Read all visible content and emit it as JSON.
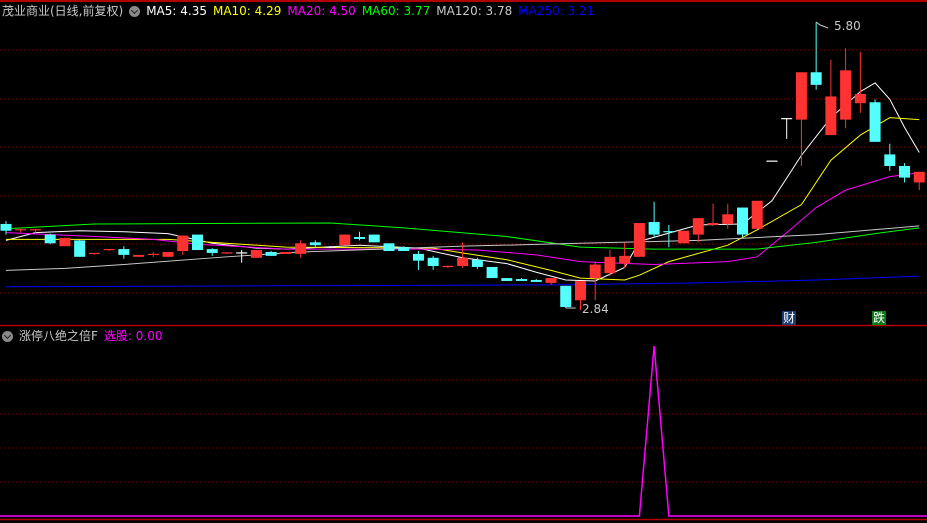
{
  "header": {
    "title": "茂业商业(日线,前复权)",
    "ma": [
      {
        "label": "MA5: 4.35",
        "color": "#ffffff"
      },
      {
        "label": "MA10: 4.29",
        "color": "#ffff00"
      },
      {
        "label": "MA20: 4.50",
        "color": "#ff00ff"
      },
      {
        "label": "MA60: 3.77",
        "color": "#00ff00"
      },
      {
        "label": "MA120: 3.78",
        "color": "#c8c8c8"
      },
      {
        "label": "MA250: 3.21",
        "color": "#0000ff"
      }
    ]
  },
  "indicator": {
    "title": "涨停八绝之倍F",
    "value_label": "选股: 0.00",
    "color": "#ff00ff"
  },
  "annotations": {
    "high_label": "5.80",
    "low_label": "2.84",
    "tag1": "财",
    "tag2": "跌"
  },
  "colors": {
    "up": "#ff3232",
    "down": "#54ffff",
    "flat": "#ffffff",
    "grid": "#8b0000",
    "border": "#b00000"
  },
  "chart_data": [
    {
      "type": "candlestick",
      "title": "茂业商业(日线,前复权)",
      "ylim": [
        2.8,
        5.85
      ],
      "candles_ohlc": [
        [
          3.71,
          3.74,
          3.6,
          3.64
        ],
        [
          3.64,
          3.66,
          3.62,
          3.65
        ],
        [
          3.64,
          3.66,
          3.62,
          3.65
        ],
        [
          3.6,
          3.61,
          3.5,
          3.51
        ],
        [
          3.48,
          3.57,
          3.48,
          3.565
        ],
        [
          3.54,
          3.55,
          3.37,
          3.37
        ],
        [
          3.4,
          3.41,
          3.39,
          3.405
        ],
        [
          3.44,
          3.45,
          3.43,
          3.445
        ],
        [
          3.45,
          3.48,
          3.35,
          3.39
        ],
        [
          3.37,
          3.39,
          3.37,
          3.39
        ],
        [
          3.39,
          3.42,
          3.37,
          3.395
        ],
        [
          3.37,
          3.42,
          3.37,
          3.42
        ],
        [
          3.43,
          3.59,
          3.39,
          3.59
        ],
        [
          3.6,
          3.6,
          3.44,
          3.44
        ],
        [
          3.45,
          3.46,
          3.38,
          3.41
        ],
        [
          3.4,
          3.41,
          3.4,
          3.41
        ],
        [
          3.41,
          3.44,
          3.31,
          3.41
        ],
        [
          3.36,
          3.44,
          3.36,
          3.44
        ],
        [
          3.42,
          3.43,
          3.38,
          3.38
        ],
        [
          3.4,
          3.42,
          3.4,
          3.42
        ],
        [
          3.4,
          3.54,
          3.36,
          3.51
        ],
        [
          3.52,
          3.54,
          3.47,
          3.49
        ],
        [
          3.47,
          3.48,
          3.46,
          3.47
        ],
        [
          3.49,
          3.6,
          3.49,
          3.6
        ],
        [
          3.575,
          3.63,
          3.54,
          3.555
        ],
        [
          3.6,
          3.6,
          3.52,
          3.52
        ],
        [
          3.51,
          3.51,
          3.43,
          3.43
        ],
        [
          3.47,
          3.48,
          3.43,
          3.43
        ],
        [
          3.4,
          3.43,
          3.235,
          3.33
        ],
        [
          3.36,
          3.38,
          3.235,
          3.275
        ],
        [
          3.265,
          3.28,
          3.255,
          3.27
        ],
        [
          3.275,
          3.52,
          3.255,
          3.36
        ],
        [
          3.34,
          3.36,
          3.245,
          3.265
        ],
        [
          3.265,
          3.265,
          3.15,
          3.15
        ],
        [
          3.15,
          3.15,
          3.12,
          3.12
        ],
        [
          3.14,
          3.15,
          3.12,
          3.12
        ],
        [
          3.13,
          3.14,
          3.11,
          3.11
        ],
        [
          3.1,
          3.15,
          3.08,
          3.15
        ],
        [
          3.07,
          3.07,
          2.84,
          2.85
        ],
        [
          2.92,
          3.12,
          2.82,
          3.12
        ],
        [
          3.15,
          3.32,
          2.92,
          3.29
        ],
        [
          3.2,
          3.44,
          3.17,
          3.37
        ],
        [
          3.3,
          3.52,
          3.255,
          3.38
        ],
        [
          3.37,
          3.72,
          3.37,
          3.72
        ],
        [
          3.73,
          3.94,
          3.565,
          3.6
        ],
        [
          3.63,
          3.7,
          3.47,
          3.62
        ],
        [
          3.51,
          3.64,
          3.51,
          3.64
        ],
        [
          3.6,
          3.77,
          3.52,
          3.77
        ],
        [
          3.7,
          3.92,
          3.69,
          3.72
        ],
        [
          3.71,
          3.92,
          3.66,
          3.81
        ],
        [
          3.88,
          3.88,
          3.575,
          3.6
        ],
        [
          3.66,
          3.95,
          3.66,
          3.95
        ],
        [
          4.36,
          4.36,
          4.36,
          4.36
        ],
        [
          4.8,
          4.8,
          4.59,
          4.8
        ],
        [
          4.79,
          5.28,
          4.31,
          5.28
        ],
        [
          5.28,
          5.8,
          5.1,
          5.15
        ],
        [
          4.63,
          5.41,
          4.63,
          5.03
        ],
        [
          4.79,
          5.53,
          4.7,
          5.3
        ],
        [
          4.96,
          5.49,
          4.86,
          5.055
        ],
        [
          4.97,
          5.0,
          4.56,
          4.56
        ],
        [
          4.43,
          4.54,
          4.26,
          4.31
        ],
        [
          4.31,
          4.34,
          4.14,
          4.19
        ],
        [
          4.14,
          4.25,
          4.06,
          4.25
        ]
      ],
      "ma_lines": [
        {
          "name": "MA5",
          "color": "#ffffff",
          "points": [
            [
              1,
              3.54
            ],
            [
              3,
              3.62
            ],
            [
              6,
              3.64
            ],
            [
              9,
              3.63
            ],
            [
              12,
              3.61
            ],
            [
              15,
              3.51
            ],
            [
              18,
              3.46
            ],
            [
              20,
              3.45
            ],
            [
              25,
              3.49
            ],
            [
              29,
              3.46
            ],
            [
              32,
              3.36
            ],
            [
              35,
              3.3
            ],
            [
              37,
              3.21
            ],
            [
              39,
              3.13
            ],
            [
              41,
              3.12
            ],
            [
              43,
              3.26
            ],
            [
              44,
              3.53
            ],
            [
              48,
              3.7
            ],
            [
              51,
              3.71
            ],
            [
              53,
              3.95
            ],
            [
              55,
              4.42
            ],
            [
              57,
              4.81
            ],
            [
              59,
              5.08
            ],
            [
              60,
              5.17
            ],
            [
              61,
              5.0
            ],
            [
              62,
              4.71
            ],
            [
              63,
              4.45
            ]
          ]
        },
        {
          "name": "MA10",
          "color": "#ffff00",
          "points": [
            [
              1,
              3.55
            ],
            [
              12,
              3.55
            ],
            [
              14,
              3.53
            ],
            [
              20,
              3.47
            ],
            [
              30,
              3.46
            ],
            [
              32,
              3.41
            ],
            [
              35,
              3.34
            ],
            [
              38,
              3.23
            ],
            [
              40,
              3.15
            ],
            [
              43,
              3.13
            ],
            [
              44,
              3.18
            ],
            [
              46,
              3.32
            ],
            [
              50,
              3.49
            ],
            [
              52,
              3.65
            ],
            [
              55,
              3.91
            ],
            [
              57,
              4.37
            ],
            [
              59,
              4.63
            ],
            [
              61,
              4.81
            ],
            [
              63,
              4.79
            ]
          ]
        },
        {
          "name": "MA20",
          "color": "#ff00ff",
          "points": [
            [
              1,
              3.62
            ],
            [
              7,
              3.58
            ],
            [
              11,
              3.55
            ],
            [
              14,
              3.5
            ],
            [
              20,
              3.45
            ],
            [
              29,
              3.45
            ],
            [
              33,
              3.44
            ],
            [
              37,
              3.39
            ],
            [
              40,
              3.32
            ],
            [
              45,
              3.29
            ],
            [
              50,
              3.32
            ],
            [
              52,
              3.37
            ],
            [
              54,
              3.62
            ],
            [
              56,
              3.88
            ],
            [
              58,
              4.06
            ],
            [
              61,
              4.2
            ],
            [
              63,
              4.24
            ]
          ]
        },
        {
          "name": "MA60",
          "color": "#00ff00",
          "points": [
            [
              1,
              3.66
            ],
            [
              7,
              3.71
            ],
            [
              23,
              3.72
            ],
            [
              28,
              3.67
            ],
            [
              35,
              3.58
            ],
            [
              40,
              3.47
            ],
            [
              45,
              3.45
            ],
            [
              52,
              3.45
            ],
            [
              56,
              3.52
            ],
            [
              60,
              3.61
            ],
            [
              63,
              3.67
            ]
          ]
        },
        {
          "name": "MA120",
          "color": "#c8c8c8",
          "points": [
            [
              1,
              3.23
            ],
            [
              5,
              3.25
            ],
            [
              9,
              3.29
            ],
            [
              16,
              3.37
            ],
            [
              21,
              3.42
            ],
            [
              32,
              3.48
            ],
            [
              40,
              3.51
            ],
            [
              48,
              3.54
            ],
            [
              56,
              3.6
            ],
            [
              63,
              3.69
            ]
          ]
        },
        {
          "name": "MA250",
          "color": "#0000ff",
          "points": [
            [
              1,
              3.06
            ],
            [
              20,
              3.07
            ],
            [
              38,
              3.08
            ],
            [
              48,
              3.1
            ],
            [
              56,
              3.13
            ],
            [
              63,
              3.17
            ]
          ]
        }
      ],
      "high": {
        "index": 56,
        "value": 5.8
      },
      "low": {
        "index": 39,
        "value": 2.84
      },
      "grid": true
    },
    {
      "type": "line",
      "title": "涨停八绝之倍F",
      "ylim": [
        0,
        1
      ],
      "series": [
        {
          "name": "选股",
          "color": "#ff00ff",
          "signal_index": 45,
          "signal_value": 1,
          "count": 63
        }
      ],
      "grid": true
    }
  ]
}
